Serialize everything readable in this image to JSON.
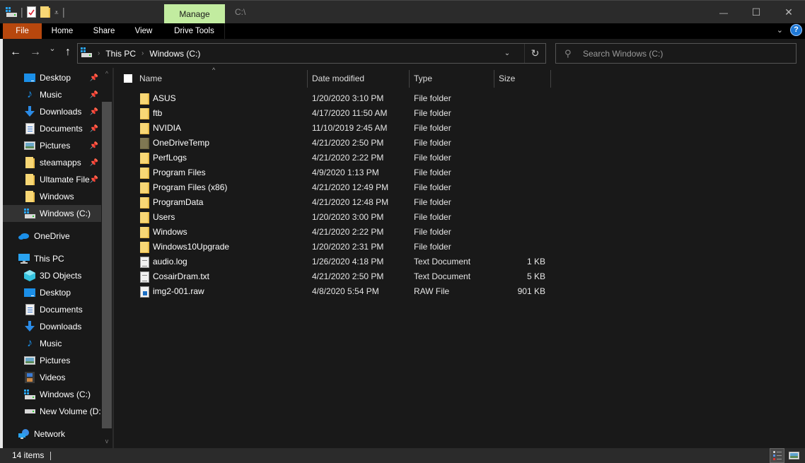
{
  "window": {
    "title_path": "C:\\",
    "contextual_tab": "Manage",
    "controls": {
      "minimize": "—",
      "maximize": "☐",
      "close": "✕"
    }
  },
  "quick_access_toolbar": {
    "icons": [
      "drive-icon",
      "properties-icon",
      "new-folder-icon",
      "customize-dropdown-icon"
    ]
  },
  "ribbon": {
    "tabs": [
      {
        "label": "File",
        "accent": "#b7470d"
      },
      {
        "label": "Home"
      },
      {
        "label": "Share"
      },
      {
        "label": "View"
      },
      {
        "label": "Drive Tools"
      }
    ],
    "manage_color": "#c2eca0",
    "help_label": "?"
  },
  "navigation": {
    "back": "←",
    "forward": "→",
    "recent": "⌄",
    "up": "↑",
    "breadcrumb": [
      "This PC",
      "Windows (C:)"
    ],
    "refresh": "↻",
    "search_placeholder": "Search Windows (C:)"
  },
  "sidebar": {
    "quick_access": [
      {
        "label": "Desktop",
        "icon": "desktop-icon",
        "pinned": true
      },
      {
        "label": "Music",
        "icon": "music-icon",
        "pinned": true
      },
      {
        "label": "Downloads",
        "icon": "downloads-icon",
        "pinned": true
      },
      {
        "label": "Documents",
        "icon": "documents-icon",
        "pinned": true
      },
      {
        "label": "Pictures",
        "icon": "pictures-icon",
        "pinned": true
      },
      {
        "label": "steamapps",
        "icon": "folder-icon",
        "pinned": true
      },
      {
        "label": "Ultamate File",
        "icon": "folder-icon",
        "pinned": true
      },
      {
        "label": "Windows",
        "icon": "folder-icon",
        "pinned": false
      },
      {
        "label": "Windows (C:)",
        "icon": "drive-icon",
        "pinned": false,
        "selected": true
      }
    ],
    "onedrive": {
      "label": "OneDrive",
      "icon": "onedrive-icon"
    },
    "this_pc": {
      "label": "This PC",
      "icon": "computer-icon"
    },
    "this_pc_items": [
      {
        "label": "3D Objects",
        "icon": "3d-objects-icon"
      },
      {
        "label": "Desktop",
        "icon": "desktop-icon"
      },
      {
        "label": "Documents",
        "icon": "documents-icon"
      },
      {
        "label": "Downloads",
        "icon": "downloads-icon"
      },
      {
        "label": "Music",
        "icon": "music-icon"
      },
      {
        "label": "Pictures",
        "icon": "pictures-icon"
      },
      {
        "label": "Videos",
        "icon": "videos-icon"
      },
      {
        "label": "Windows (C:)",
        "icon": "drive-icon"
      },
      {
        "label": "New Volume (D:)",
        "icon": "drive-icon"
      }
    ],
    "network": {
      "label": "Network",
      "icon": "network-icon"
    }
  },
  "file_list": {
    "columns": [
      "Name",
      "Date modified",
      "Type",
      "Size"
    ],
    "sorted_by": "Name",
    "rows": [
      {
        "name": "ASUS",
        "date": "1/20/2020 3:10 PM",
        "type": "File folder",
        "size": "",
        "icon": "folder"
      },
      {
        "name": "ftb",
        "date": "4/17/2020 11:50 AM",
        "type": "File folder",
        "size": "",
        "icon": "folder"
      },
      {
        "name": "NVIDIA",
        "date": "11/10/2019 2:45 AM",
        "type": "File folder",
        "size": "",
        "icon": "folder"
      },
      {
        "name": "OneDriveTemp",
        "date": "4/21/2020 2:50 PM",
        "type": "File folder",
        "size": "",
        "icon": "folder-hidden"
      },
      {
        "name": "PerfLogs",
        "date": "4/21/2020 2:22 PM",
        "type": "File folder",
        "size": "",
        "icon": "folder"
      },
      {
        "name": "Program Files",
        "date": "4/9/2020 1:13 PM",
        "type": "File folder",
        "size": "",
        "icon": "folder"
      },
      {
        "name": "Program Files (x86)",
        "date": "4/21/2020 12:49 PM",
        "type": "File folder",
        "size": "",
        "icon": "folder"
      },
      {
        "name": "ProgramData",
        "date": "4/21/2020 12:48 PM",
        "type": "File folder",
        "size": "",
        "icon": "folder"
      },
      {
        "name": "Users",
        "date": "1/20/2020 3:00 PM",
        "type": "File folder",
        "size": "",
        "icon": "folder"
      },
      {
        "name": "Windows",
        "date": "4/21/2020 2:22 PM",
        "type": "File folder",
        "size": "",
        "icon": "folder"
      },
      {
        "name": "Windows10Upgrade",
        "date": "1/20/2020 2:31 PM",
        "type": "File folder",
        "size": "",
        "icon": "folder"
      },
      {
        "name": "audio.log",
        "date": "1/26/2020 4:18 PM",
        "type": "Text Document",
        "size": "1 KB",
        "icon": "text"
      },
      {
        "name": "CosairDram.txt",
        "date": "4/21/2020 2:50 PM",
        "type": "Text Document",
        "size": "5 KB",
        "icon": "text"
      },
      {
        "name": "img2-001.raw",
        "date": "4/8/2020 5:54 PM",
        "type": "RAW File",
        "size": "901 KB",
        "icon": "raw"
      }
    ]
  },
  "status_bar": {
    "item_count": "14 items",
    "views": [
      "details-view",
      "large-icons-view"
    ],
    "active_view": "details-view"
  }
}
